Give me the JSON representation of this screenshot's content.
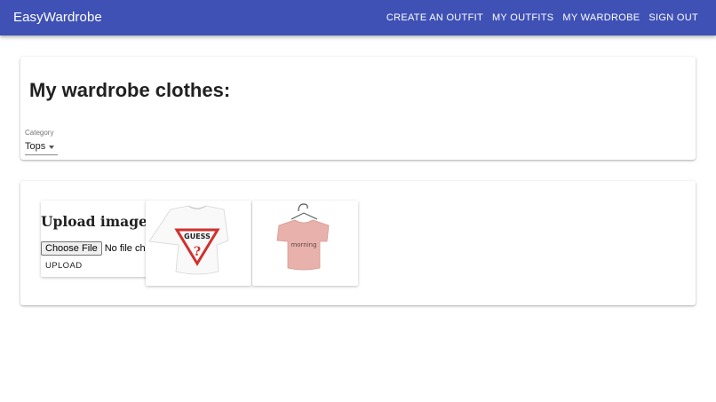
{
  "appbar": {
    "brand": "EasyWardrobe",
    "nav": [
      "CREATE AN OUTFIT",
      "MY OUTFITS",
      "MY WARDROBE",
      "SIGN OUT"
    ],
    "color": "#3f51b5"
  },
  "wardrobe": {
    "title": "My wardrobe clothes:",
    "category_label": "Category",
    "category_value": "Tops"
  },
  "upload": {
    "title": "Upload image",
    "choose_label": "Choose File",
    "file_status": "No file chosen",
    "upload_label": "UPLOAD"
  },
  "items": [
    {
      "name": "white-guess-crop-top",
      "print": "GUESS",
      "color": "#ffffff"
    },
    {
      "name": "pink-morning-crop-top",
      "print": "morning",
      "color": "#e8b1ab"
    }
  ]
}
